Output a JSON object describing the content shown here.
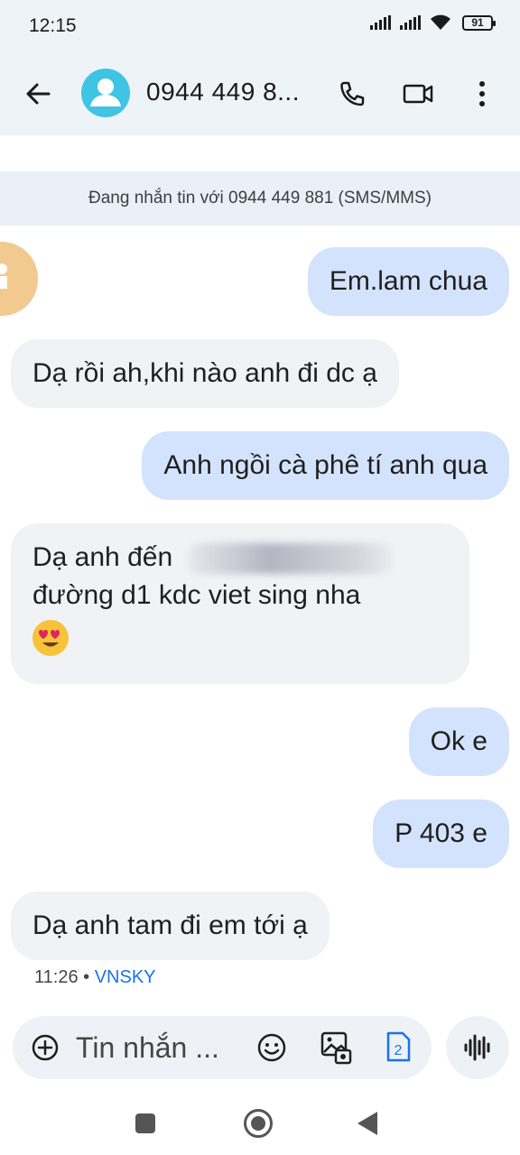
{
  "status_bar": {
    "time": "12:15",
    "battery": "91",
    "icons": [
      "signal-icon",
      "signal-icon",
      "wifi-icon",
      "battery-icon"
    ]
  },
  "app_bar": {
    "contact": "0944 449 8...",
    "actions": [
      "back-arrow-icon",
      "phone-icon",
      "video-icon",
      "more-vert-icon"
    ]
  },
  "banner": {
    "text": "Đang nhắn tin với 0944 449 881 (SMS/MMS)"
  },
  "messages": [
    {
      "direction": "out",
      "text": "Em.lam chua"
    },
    {
      "direction": "in",
      "text": "Dạ rồi ah,khi nào anh đi dc ạ"
    },
    {
      "direction": "out",
      "text": "Anh ngồi cà phê tí anh qua"
    },
    {
      "direction": "in",
      "line1": "Dạ anh đến",
      "line2": "đường d1 kdc viet sing nha",
      "emoji": "heart-eyes-emoji"
    },
    {
      "direction": "out",
      "text": "Ok e"
    },
    {
      "direction": "out",
      "text": "P 403 e"
    },
    {
      "direction": "in",
      "text": "Dạ anh tam đi em tới ạ"
    }
  ],
  "meta": {
    "time": "11:26",
    "separator": "•",
    "carrier": "VNSKY"
  },
  "compose": {
    "placeholder": "Tin nhắn ...",
    "sim": "2"
  },
  "colors": {
    "outgoing_bubble": "#d3e3fd",
    "incoming_bubble": "#f0f2f5",
    "header_bg": "#eef3f8",
    "avatar": "#3fc4e3",
    "carrier_link": "#1a73e8"
  }
}
